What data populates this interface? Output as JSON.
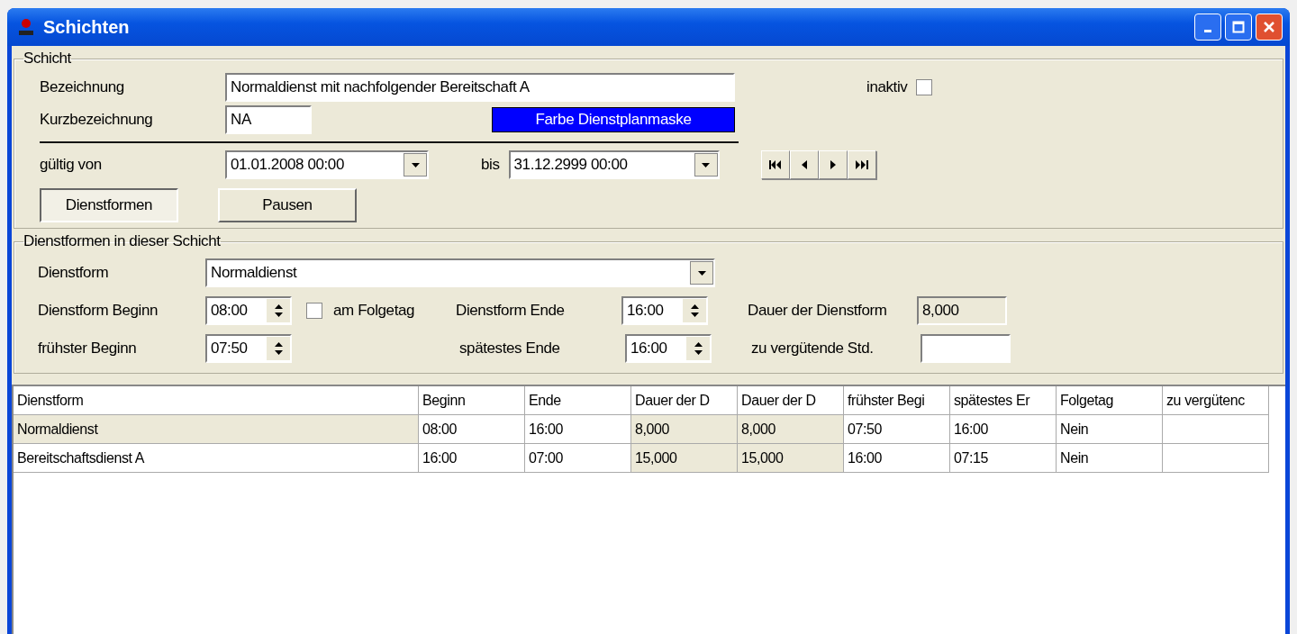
{
  "window": {
    "title": "Schichten"
  },
  "schicht": {
    "legend": "Schicht",
    "bezeichnung": {
      "label": "Bezeichnung",
      "value": "Normaldienst mit nachfolgender Bereitschaft A"
    },
    "kurzbezeichnung": {
      "label": "Kurzbezeichnung",
      "value": "NA"
    },
    "color_button": {
      "label": "Farbe Dienstplanmaske",
      "color": "#0000ff"
    },
    "inaktiv": {
      "label": "inaktiv",
      "checked": false
    },
    "gueltig_von": {
      "label": "gültig von",
      "value": "01.01.2008 00:00"
    },
    "bis": {
      "label": "bis",
      "value": "31.12.2999 00:00"
    },
    "tabs": [
      {
        "label": "Dienstformen",
        "selected": true
      },
      {
        "label": "Pausen",
        "selected": false
      }
    ]
  },
  "dienstformen": {
    "legend": "Dienstformen in dieser Schicht",
    "dienstform": {
      "label": "Dienstform",
      "value": "Normaldienst"
    },
    "beginn": {
      "label": "Dienstform Beginn",
      "value": "08:00"
    },
    "am_folgetag": {
      "label": "am Folgetag",
      "checked": false
    },
    "ende": {
      "label": "Dienstform Ende",
      "value": "16:00"
    },
    "dauer": {
      "label": "Dauer der Dienstform",
      "value": "8,000"
    },
    "fruehster_beginn": {
      "label": "frühster Beginn",
      "value": "07:50"
    },
    "spaetestes_ende": {
      "label": "spätestes Ende",
      "value": "16:00"
    },
    "zu_verguetende": {
      "label": "zu vergütende Std."
    }
  },
  "table": {
    "columns": [
      {
        "label": "Dienstform",
        "shaded": false
      },
      {
        "label": "Beginn",
        "shaded": false
      },
      {
        "label": "Ende",
        "shaded": false
      },
      {
        "label": "Dauer der D",
        "shaded": true
      },
      {
        "label": "Dauer der D",
        "shaded": true
      },
      {
        "label": "frühster Begi",
        "shaded": false
      },
      {
        "label": "spätestes Er",
        "shaded": false
      },
      {
        "label": "Folgetag",
        "shaded": false
      },
      {
        "label": "zu vergütenc",
        "shaded": false
      }
    ],
    "rows": [
      {
        "selected": true,
        "cells": [
          "Normaldienst",
          "08:00",
          "16:00",
          "8,000",
          "8,000",
          "07:50",
          "16:00",
          "Nein",
          ""
        ]
      },
      {
        "selected": false,
        "cells": [
          "Bereitschaftsdienst A",
          "16:00",
          "07:00",
          "15,000",
          "15,000",
          "16:00",
          "07:15",
          "Nein",
          ""
        ]
      }
    ]
  }
}
